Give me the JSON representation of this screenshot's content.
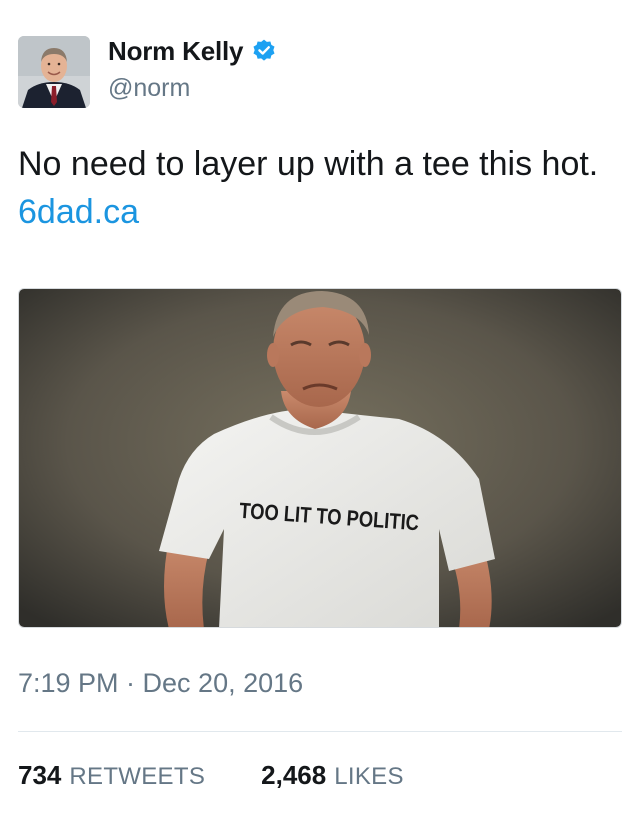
{
  "user": {
    "display_name": "Norm Kelly",
    "handle": "@norm",
    "verified": true,
    "avatar_icon": "profile-photo"
  },
  "tweet": {
    "text": "No need to layer up with a tee this hot.",
    "link_text": "6dad.ca",
    "timestamp": "7:19 PM · Dec 20, 2016"
  },
  "media": {
    "shirt_text": "TOO LIT TO POLITIC"
  },
  "stats": {
    "retweets_count": "734",
    "retweets_label": "RETWEETS",
    "likes_count": "2,468",
    "likes_label": "LIKES"
  },
  "colors": {
    "link": "#1b95e0",
    "verified": "#1da1f2",
    "secondary_text": "#657786"
  }
}
